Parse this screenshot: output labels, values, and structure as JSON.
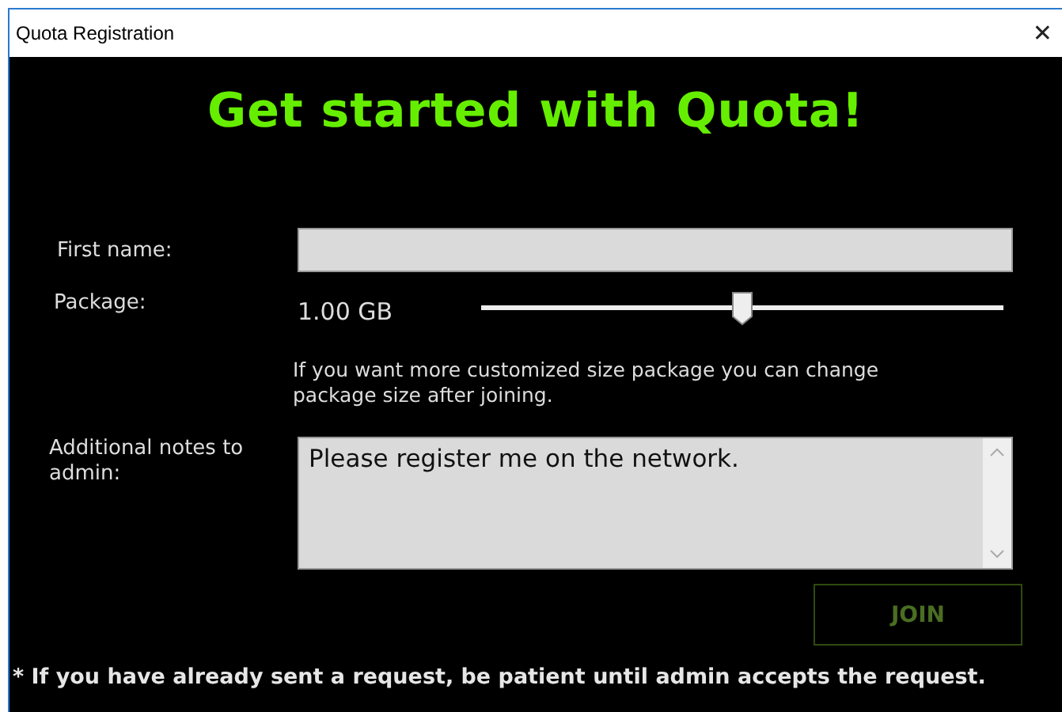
{
  "window": {
    "title": "Quota Registration",
    "close": "✕"
  },
  "heading": "Get started with Quota!",
  "first_name": {
    "label": "First name:"
  },
  "package": {
    "label": "Package:",
    "reading": "1.00 GB",
    "level": 0.5,
    "hint": "If you want more customized size package you can change package size after joining."
  },
  "notes": {
    "label": "Additional notes to admin:",
    "value": "Please register me on the network."
  },
  "join_button": {
    "label": "JOIN",
    "disabled": true
  },
  "footer": "* If you have already sent a request, be patient until admin accepts the request."
}
